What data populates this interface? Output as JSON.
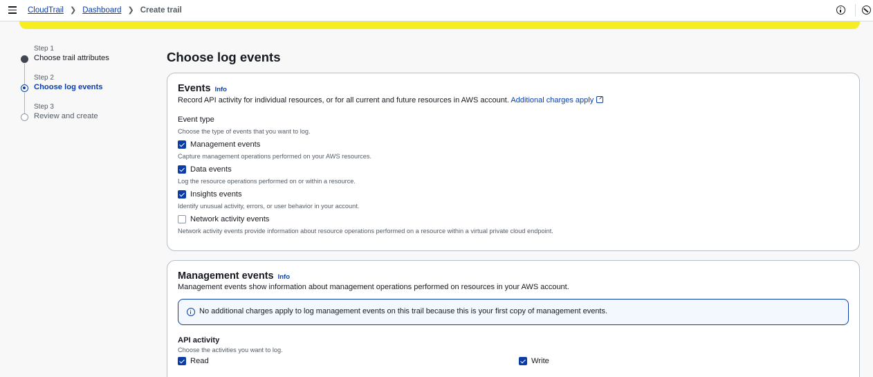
{
  "breadcrumb": {
    "items": [
      "CloudTrail",
      "Dashboard"
    ],
    "current": "Create trail"
  },
  "icons": {
    "menu": "hamburger-icon",
    "info": "info-circle-icon",
    "settings": "settings-icon",
    "external": "external-link-icon",
    "check": "checkmark-icon"
  },
  "colors": {
    "accent": "#0b3da8",
    "banner": "#f6ee21",
    "alert_bg": "#f2f8fd"
  },
  "steps": [
    {
      "sub": "Step 1",
      "label": "Choose trail attributes",
      "state": "done"
    },
    {
      "sub": "Step 2",
      "label": "Choose log events",
      "state": "active"
    },
    {
      "sub": "Step 3",
      "label": "Review and create",
      "state": "pending"
    }
  ],
  "page_title": "Choose log events",
  "events_card": {
    "title": "Events",
    "info": "Info",
    "desc": "Record API activity for individual resources, or for all current and future resources in AWS account.",
    "charges_link": "Additional charges apply",
    "event_type_label": "Event type",
    "event_type_hint": "Choose the type of events that you want to log.",
    "options": [
      {
        "label": "Management events",
        "hint": "Capture management operations performed on your AWS resources.",
        "checked": true
      },
      {
        "label": "Data events",
        "hint": "Log the resource operations performed on or within a resource.",
        "checked": true
      },
      {
        "label": "Insights events",
        "hint": "Identify unusual activity, errors, or user behavior in your account.",
        "checked": true
      },
      {
        "label": "Network activity events",
        "hint": "Network activity events provide information about resource operations performed on a resource within a virtual private cloud endpoint.",
        "checked": false
      }
    ]
  },
  "mgmt_card": {
    "title": "Management events",
    "info": "Info",
    "desc": "Management events show information about management operations performed on resources in your AWS account.",
    "alert": "No additional charges apply to log management events on this trail because this is your first copy of management events.",
    "api_label": "API activity",
    "api_hint": "Choose the activities you want to log.",
    "read": {
      "label": "Read",
      "checked": true
    },
    "write": {
      "label": "Write",
      "checked": true
    }
  }
}
